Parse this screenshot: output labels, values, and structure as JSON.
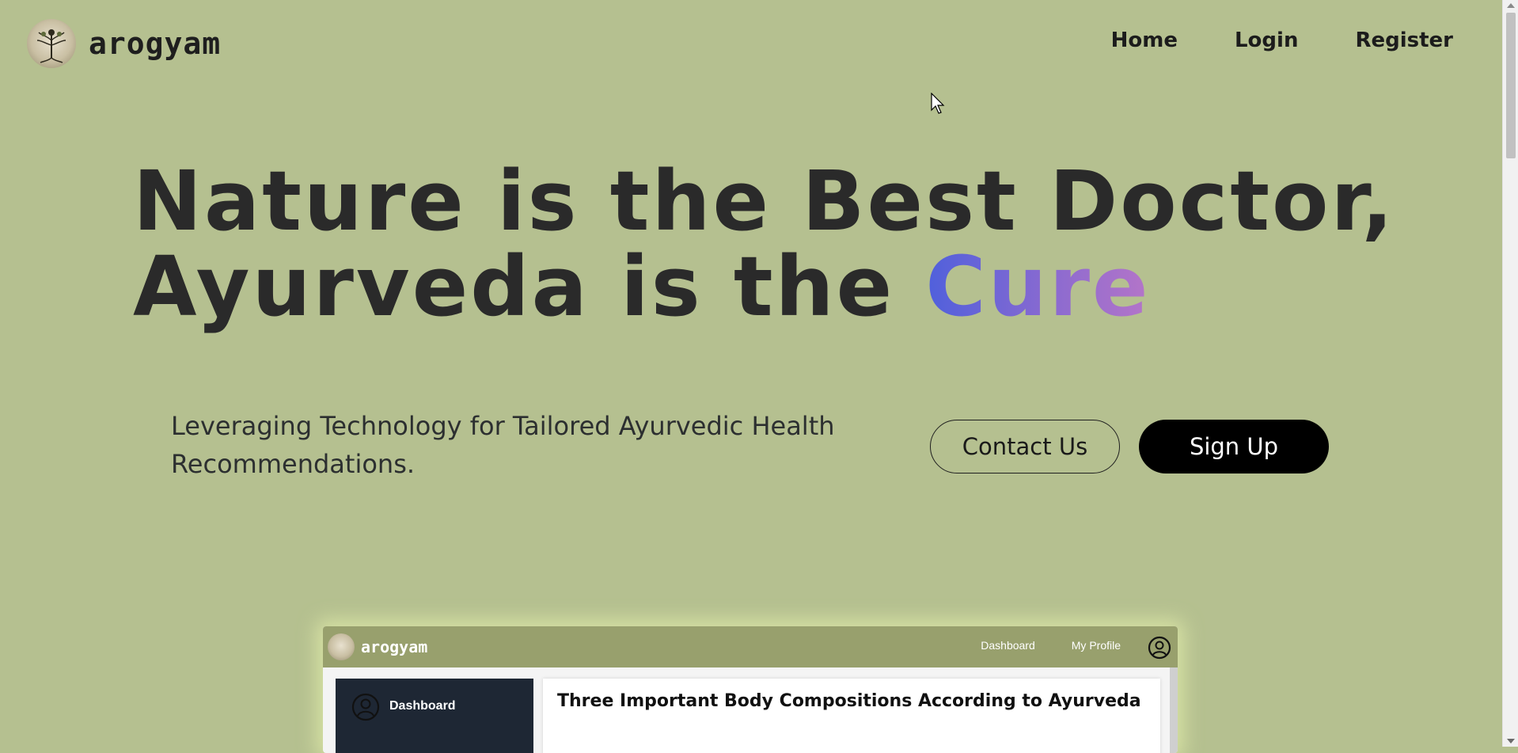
{
  "brand": {
    "name": "arogyam",
    "logo_icon": "ayurveda-tree-logo-icon"
  },
  "nav": {
    "items": [
      {
        "label": "Home"
      },
      {
        "label": "Login"
      },
      {
        "label": "Register"
      }
    ]
  },
  "hero": {
    "title_line1": "Nature is the Best Doctor,",
    "title_line2_prefix": "Ayurveda is the ",
    "title_line2_highlight": "Cure",
    "subtitle": "Leveraging Technology for Tailored Ayurvedic Health Recommendations.",
    "contact_label": "Contact Us",
    "signup_label": "Sign Up"
  },
  "preview": {
    "brand": "arogyam",
    "nav": [
      "Dashboard",
      "My Profile"
    ],
    "user_icon": "user-circle-icon",
    "sidebar_label": "Dashboard",
    "article_title": "Three Important Body Compositions According to Ayurveda"
  },
  "colors": {
    "background": "#b5c090",
    "gradient_start": "#4f60dc",
    "gradient_end": "#b575c8",
    "preview_bar": "#98a06d",
    "preview_sidebar": "#1e2734"
  }
}
